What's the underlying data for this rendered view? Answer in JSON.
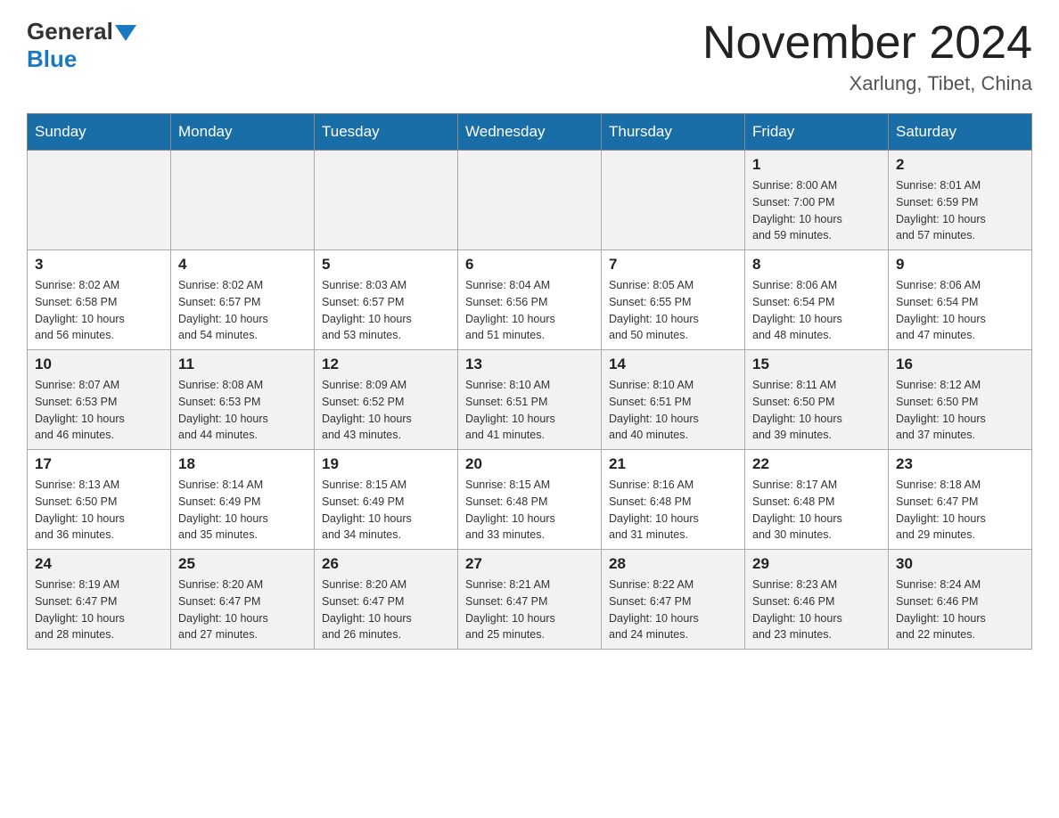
{
  "header": {
    "logo_general": "General",
    "logo_blue": "Blue",
    "month_title": "November 2024",
    "location": "Xarlung, Tibet, China"
  },
  "days_of_week": [
    "Sunday",
    "Monday",
    "Tuesday",
    "Wednesday",
    "Thursday",
    "Friday",
    "Saturday"
  ],
  "weeks": [
    [
      {
        "day": "",
        "info": ""
      },
      {
        "day": "",
        "info": ""
      },
      {
        "day": "",
        "info": ""
      },
      {
        "day": "",
        "info": ""
      },
      {
        "day": "",
        "info": ""
      },
      {
        "day": "1",
        "info": "Sunrise: 8:00 AM\nSunset: 7:00 PM\nDaylight: 10 hours\nand 59 minutes."
      },
      {
        "day": "2",
        "info": "Sunrise: 8:01 AM\nSunset: 6:59 PM\nDaylight: 10 hours\nand 57 minutes."
      }
    ],
    [
      {
        "day": "3",
        "info": "Sunrise: 8:02 AM\nSunset: 6:58 PM\nDaylight: 10 hours\nand 56 minutes."
      },
      {
        "day": "4",
        "info": "Sunrise: 8:02 AM\nSunset: 6:57 PM\nDaylight: 10 hours\nand 54 minutes."
      },
      {
        "day": "5",
        "info": "Sunrise: 8:03 AM\nSunset: 6:57 PM\nDaylight: 10 hours\nand 53 minutes."
      },
      {
        "day": "6",
        "info": "Sunrise: 8:04 AM\nSunset: 6:56 PM\nDaylight: 10 hours\nand 51 minutes."
      },
      {
        "day": "7",
        "info": "Sunrise: 8:05 AM\nSunset: 6:55 PM\nDaylight: 10 hours\nand 50 minutes."
      },
      {
        "day": "8",
        "info": "Sunrise: 8:06 AM\nSunset: 6:54 PM\nDaylight: 10 hours\nand 48 minutes."
      },
      {
        "day": "9",
        "info": "Sunrise: 8:06 AM\nSunset: 6:54 PM\nDaylight: 10 hours\nand 47 minutes."
      }
    ],
    [
      {
        "day": "10",
        "info": "Sunrise: 8:07 AM\nSunset: 6:53 PM\nDaylight: 10 hours\nand 46 minutes."
      },
      {
        "day": "11",
        "info": "Sunrise: 8:08 AM\nSunset: 6:53 PM\nDaylight: 10 hours\nand 44 minutes."
      },
      {
        "day": "12",
        "info": "Sunrise: 8:09 AM\nSunset: 6:52 PM\nDaylight: 10 hours\nand 43 minutes."
      },
      {
        "day": "13",
        "info": "Sunrise: 8:10 AM\nSunset: 6:51 PM\nDaylight: 10 hours\nand 41 minutes."
      },
      {
        "day": "14",
        "info": "Sunrise: 8:10 AM\nSunset: 6:51 PM\nDaylight: 10 hours\nand 40 minutes."
      },
      {
        "day": "15",
        "info": "Sunrise: 8:11 AM\nSunset: 6:50 PM\nDaylight: 10 hours\nand 39 minutes."
      },
      {
        "day": "16",
        "info": "Sunrise: 8:12 AM\nSunset: 6:50 PM\nDaylight: 10 hours\nand 37 minutes."
      }
    ],
    [
      {
        "day": "17",
        "info": "Sunrise: 8:13 AM\nSunset: 6:50 PM\nDaylight: 10 hours\nand 36 minutes."
      },
      {
        "day": "18",
        "info": "Sunrise: 8:14 AM\nSunset: 6:49 PM\nDaylight: 10 hours\nand 35 minutes."
      },
      {
        "day": "19",
        "info": "Sunrise: 8:15 AM\nSunset: 6:49 PM\nDaylight: 10 hours\nand 34 minutes."
      },
      {
        "day": "20",
        "info": "Sunrise: 8:15 AM\nSunset: 6:48 PM\nDaylight: 10 hours\nand 33 minutes."
      },
      {
        "day": "21",
        "info": "Sunrise: 8:16 AM\nSunset: 6:48 PM\nDaylight: 10 hours\nand 31 minutes."
      },
      {
        "day": "22",
        "info": "Sunrise: 8:17 AM\nSunset: 6:48 PM\nDaylight: 10 hours\nand 30 minutes."
      },
      {
        "day": "23",
        "info": "Sunrise: 8:18 AM\nSunset: 6:47 PM\nDaylight: 10 hours\nand 29 minutes."
      }
    ],
    [
      {
        "day": "24",
        "info": "Sunrise: 8:19 AM\nSunset: 6:47 PM\nDaylight: 10 hours\nand 28 minutes."
      },
      {
        "day": "25",
        "info": "Sunrise: 8:20 AM\nSunset: 6:47 PM\nDaylight: 10 hours\nand 27 minutes."
      },
      {
        "day": "26",
        "info": "Sunrise: 8:20 AM\nSunset: 6:47 PM\nDaylight: 10 hours\nand 26 minutes."
      },
      {
        "day": "27",
        "info": "Sunrise: 8:21 AM\nSunset: 6:47 PM\nDaylight: 10 hours\nand 25 minutes."
      },
      {
        "day": "28",
        "info": "Sunrise: 8:22 AM\nSunset: 6:47 PM\nDaylight: 10 hours\nand 24 minutes."
      },
      {
        "day": "29",
        "info": "Sunrise: 8:23 AM\nSunset: 6:46 PM\nDaylight: 10 hours\nand 23 minutes."
      },
      {
        "day": "30",
        "info": "Sunrise: 8:24 AM\nSunset: 6:46 PM\nDaylight: 10 hours\nand 22 minutes."
      }
    ]
  ]
}
